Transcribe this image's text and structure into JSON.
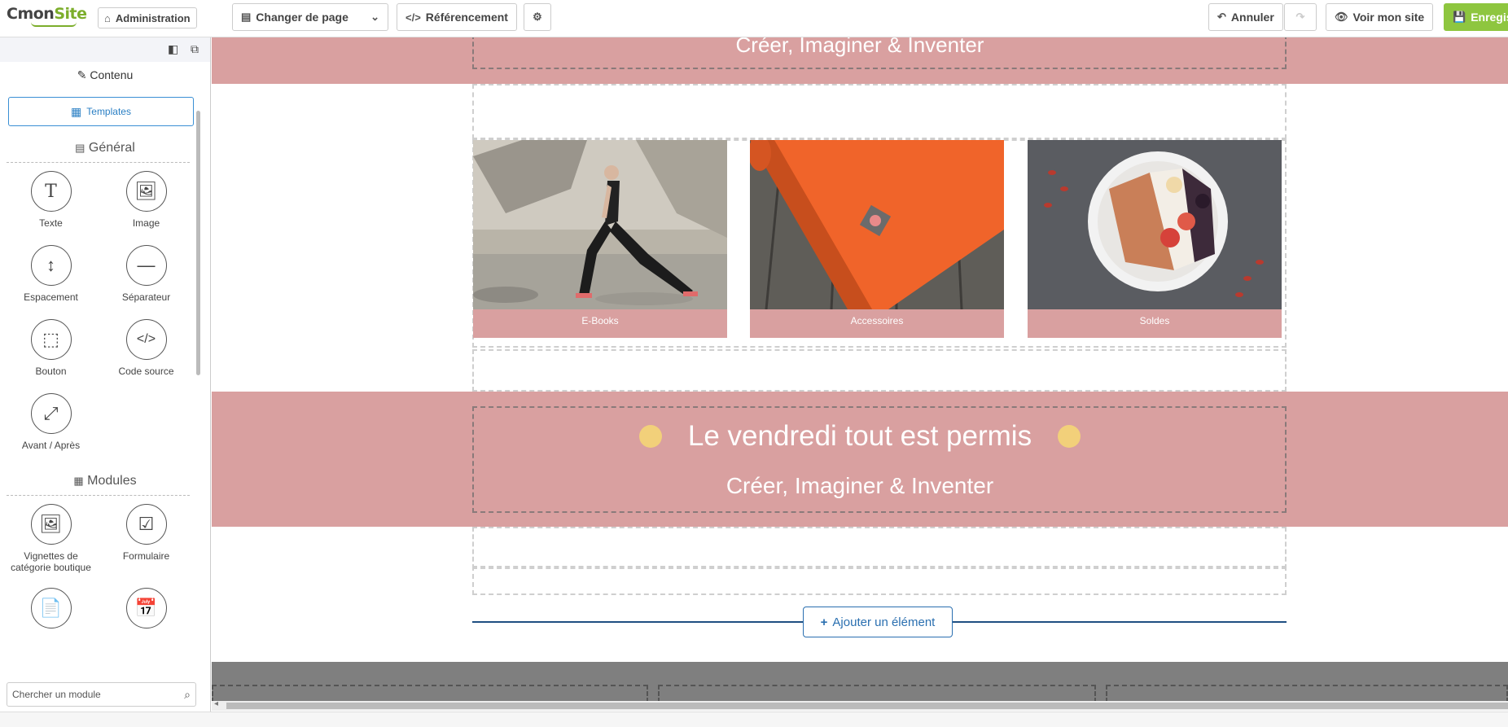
{
  "app": {
    "logo_text_a": "Cmon",
    "logo_text_b": "Site"
  },
  "toolbar": {
    "admin_label": "Administration",
    "page_select_label": "Changer de page",
    "seo_label": "Référencement",
    "undo_label": "Annuler",
    "view_site_label": "Voir mon site",
    "save_label": "Enregis"
  },
  "sidebar": {
    "contenu_label": "Contenu",
    "templates_label": "Templates",
    "general_title": "Général",
    "general_tools": [
      {
        "label": "Texte",
        "icon": "T"
      },
      {
        "label": "Image",
        "icon": "🖼"
      },
      {
        "label": "Espacement",
        "icon": "↕"
      },
      {
        "label": "Séparateur",
        "icon": "—"
      },
      {
        "label": "Bouton",
        "icon": "⬚"
      },
      {
        "label": "Code source",
        "icon": "</>"
      },
      {
        "label": "Avant / Après",
        "icon": "⤢"
      }
    ],
    "modules_title": "Modules",
    "modules_tools": [
      {
        "label": "Vignettes de catégorie boutique",
        "icon": "🖼"
      },
      {
        "label": "Formulaire",
        "icon": "☑"
      },
      {
        "label": "",
        "icon": "📄"
      },
      {
        "label": "",
        "icon": "📅"
      }
    ],
    "search_placeholder": "Chercher un module"
  },
  "canvas": {
    "top_subtitle": "Créer, Imaginer & Inventer",
    "cards": [
      {
        "label": "E-Books"
      },
      {
        "label": "Accessoires"
      },
      {
        "label": "Soldes"
      }
    ],
    "mid_title": "Le vendredi tout est permis",
    "mid_subtitle": "Créer, Imaginer & Inventer",
    "add_element_label": "Ajouter un élément"
  },
  "colors": {
    "accent_pink": "#d9a0a0",
    "accent_green": "#8ec63f",
    "link_blue": "#2a6fb0",
    "dot_yellow": "#f2d07a"
  }
}
